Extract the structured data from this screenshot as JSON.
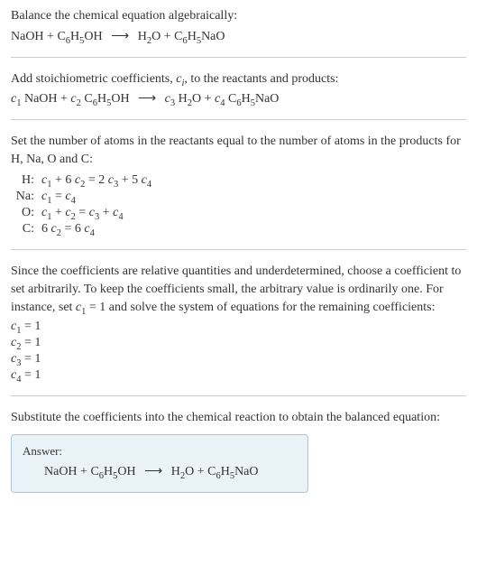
{
  "section1": {
    "line1": "Balance the chemical equation algebraically:"
  },
  "eq1": {
    "r1a": "NaOH + C",
    "r1b": "6",
    "r1c": "H",
    "r1d": "5",
    "r1e": "OH",
    "arrow": "⟶",
    "p1a": "H",
    "p1b": "2",
    "p1c": "O + C",
    "p1d": "6",
    "p1e": "H",
    "p1f": "5",
    "p1g": "NaO"
  },
  "section2": {
    "line1_a": "Add stoichiometric coefficients, ",
    "line1_b": "c",
    "line1_c": "i",
    "line1_d": ", to the reactants and products:"
  },
  "eq2": {
    "c1": "c",
    "c1s": "1",
    "r1": " NaOH + ",
    "c2": "c",
    "c2s": "2",
    "r2a": " C",
    "r2b": "6",
    "r2c": "H",
    "r2d": "5",
    "r2e": "OH",
    "arrow": "⟶",
    "c3": "c",
    "c3s": "3",
    "p1a": " H",
    "p1b": "2",
    "p1c": "O + ",
    "c4": "c",
    "c4s": "4",
    "p2a": " C",
    "p2b": "6",
    "p2c": "H",
    "p2d": "5",
    "p2e": "NaO"
  },
  "section3": {
    "line1": "Set the number of atoms in the reactants equal to the number of atoms in the products for H, Na, O and C:"
  },
  "atoms": {
    "h_label": "H:",
    "h": {
      "a": "c",
      "as": "1",
      "b": " + 6 ",
      "c": "c",
      "cs": "2",
      "d": " = 2 ",
      "e": "c",
      "es": "3",
      "f": " + 5 ",
      "g": "c",
      "gs": "4"
    },
    "na_label": "Na:",
    "na": {
      "a": "c",
      "as": "1",
      "b": " = ",
      "c": "c",
      "cs": "4"
    },
    "o_label": "O:",
    "o": {
      "a": "c",
      "as": "1",
      "b": " + ",
      "c": "c",
      "cs": "2",
      "d": " = ",
      "e": "c",
      "es": "3",
      "f": " + ",
      "g": "c",
      "gs": "4"
    },
    "c_label": "C:",
    "c": {
      "a": "6 ",
      "b": "c",
      "bs": "2",
      "d": " = 6 ",
      "e": "c",
      "es": "4"
    }
  },
  "section4": {
    "line1_a": "Since the coefficients are relative quantities and underdetermined, choose a coefficient to set arbitrarily. To keep the coefficients small, the arbitrary value is ordinarily one. For instance, set ",
    "line1_b": "c",
    "line1_c": "1",
    "line1_d": " = 1 and solve the system of equations for the remaining coefficients:"
  },
  "coeffs": {
    "c1a": "c",
    "c1b": "1",
    "c1c": " = 1",
    "c2a": "c",
    "c2b": "2",
    "c2c": " = 1",
    "c3a": "c",
    "c3b": "3",
    "c3c": " = 1",
    "c4a": "c",
    "c4b": "4",
    "c4c": " = 1"
  },
  "section5": {
    "line1": "Substitute the coefficients into the chemical reaction to obtain the balanced equation:"
  },
  "answer": {
    "label": "Answer:",
    "r1a": "NaOH + C",
    "r1b": "6",
    "r1c": "H",
    "r1d": "5",
    "r1e": "OH",
    "arrow": "⟶",
    "p1a": "H",
    "p1b": "2",
    "p1c": "O + C",
    "p1d": "6",
    "p1e": "H",
    "p1f": "5",
    "p1g": "NaO"
  }
}
